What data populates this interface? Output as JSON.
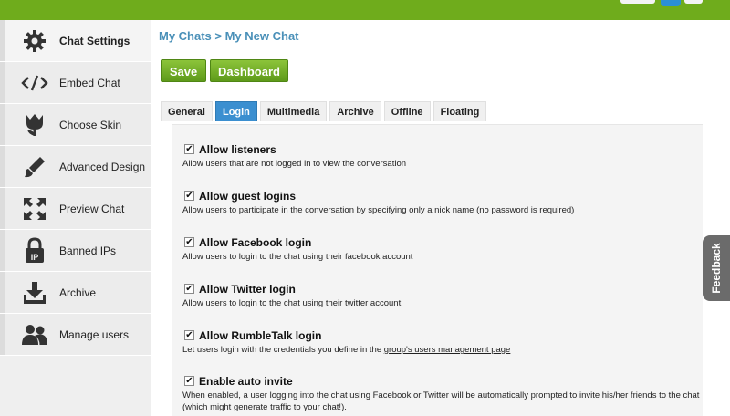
{
  "colors": {
    "topbar": "#6fac1c",
    "accent": "#4a90b8",
    "tab_active": "#3b8fd0",
    "button": "#6fac1c"
  },
  "sidebar": {
    "items": [
      {
        "label": "Chat Settings",
        "icon": "gear-icon"
      },
      {
        "label": "Embed Chat",
        "icon": "code-icon"
      },
      {
        "label": "Choose Skin",
        "icon": "tulip-icon"
      },
      {
        "label": "Advanced Design",
        "icon": "brush-icon"
      },
      {
        "label": "Preview Chat",
        "icon": "expand-arrows-icon"
      },
      {
        "label": "Banned IPs",
        "icon": "ip-lock-icon"
      },
      {
        "label": "Archive",
        "icon": "download-icon"
      },
      {
        "label": "Manage users",
        "icon": "users-icon"
      }
    ]
  },
  "breadcrumb": "My Chats > My New Chat",
  "buttons": {
    "save": "Save",
    "dashboard": "Dashboard"
  },
  "tabs": [
    "General",
    "Login",
    "Multimedia",
    "Archive",
    "Offline",
    "Floating"
  ],
  "active_tab": "Login",
  "options": [
    {
      "title": "Allow listeners",
      "checked": true,
      "desc": "Allow users that are not logged in to view the conversation"
    },
    {
      "title": "Allow guest logins",
      "checked": true,
      "desc": "Allow users to participate in the conversation by specifying only a nick name (no password is required)"
    },
    {
      "title": "Allow Facebook login",
      "checked": true,
      "desc": "Allow users to login to the chat using their facebook account"
    },
    {
      "title": "Allow Twitter login",
      "checked": true,
      "desc": "Allow users to login to the chat using their twitter account"
    },
    {
      "title": "Allow RumbleTalk login",
      "checked": true,
      "desc_prefix": "Let users login with the credentials you define in the ",
      "desc_link": "group's users management page"
    },
    {
      "title": "Enable auto invite",
      "checked": true,
      "desc": "When enabled, a user logging into the chat using Facebook or Twitter will be automatically prompted to invite his/her friends to the chat (which might generate traffic to your chat!)."
    }
  ],
  "feedback": "Feedback"
}
